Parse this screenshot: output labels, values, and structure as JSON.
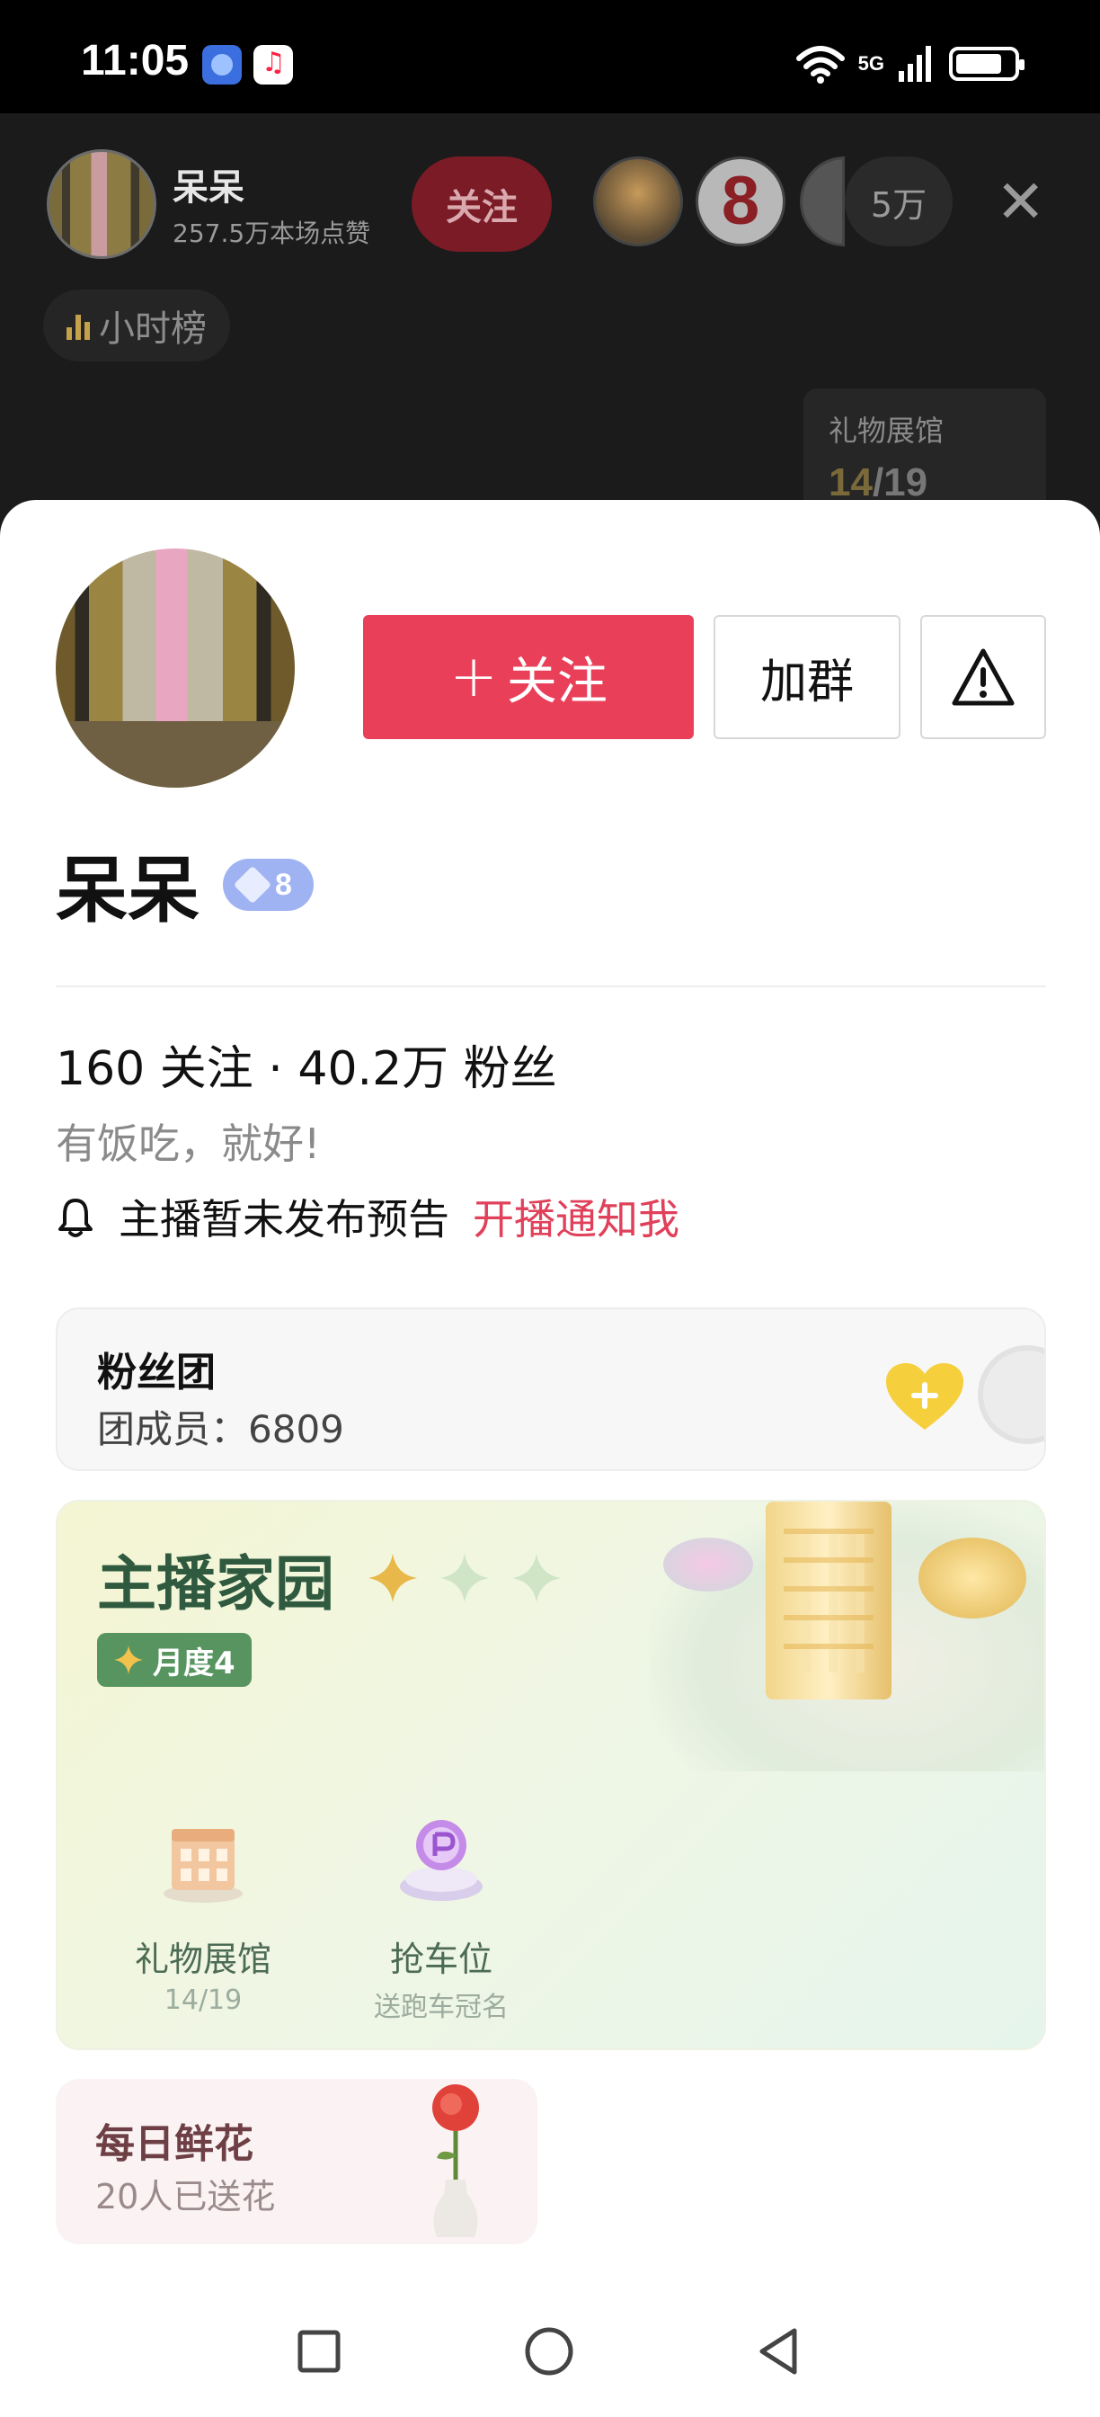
{
  "status_bar": {
    "time": "11:05",
    "network": "5G"
  },
  "live_room": {
    "host_name": "呆呆",
    "host_likes": "257.5万本场点赞",
    "follow_label": "关注",
    "viewer_rank_badge": "8",
    "viewer_count": "5万",
    "hour_rank_label": "小时榜",
    "gift_hall": {
      "label": "礼物展馆",
      "collected": "14",
      "total": "/19"
    }
  },
  "profile": {
    "follow_button": "关注",
    "group_button": "加群",
    "name": "呆呆",
    "level": "8",
    "stats": "160 关注 · 40.2万 粉丝",
    "bio": "有饭吃，就好!",
    "notice_text": "主播暂未发布预告",
    "notify_link": "开播通知我"
  },
  "fan_club": {
    "title": "粉丝团",
    "members": "团成员：6809"
  },
  "host_home": {
    "title": "主播家园",
    "month_badge": "月度4",
    "features": [
      {
        "label": "礼物展馆",
        "sub": "14/19"
      },
      {
        "label": "抢车位",
        "sub": "送跑车冠名"
      }
    ]
  },
  "daily_flower": {
    "title": "每日鲜花",
    "sub": "20人已送花"
  },
  "colors": {
    "accent_red": "#ea3f59",
    "home_green": "#2f5a3f",
    "level_blue": "#9fb3f2"
  },
  "icons": [
    "bell-icon",
    "warning-icon",
    "close-icon",
    "heart-icon",
    "sparkle-icon",
    "home-nav-icon",
    "back-nav-icon",
    "recents-nav-icon"
  ]
}
